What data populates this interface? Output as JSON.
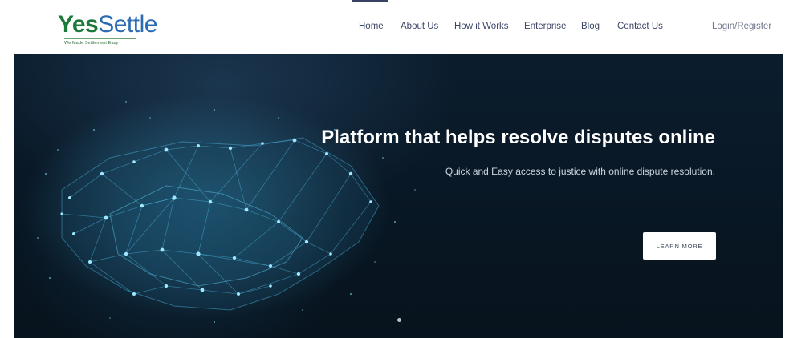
{
  "brand": {
    "name_part1": "Yes",
    "name_part2": "Settle",
    "tagline": "We Made Settlement Easy"
  },
  "nav": {
    "items": [
      {
        "label": "Home",
        "active": true
      },
      {
        "label": "About Us"
      },
      {
        "label": "How it Works"
      },
      {
        "label": "Enterprise"
      },
      {
        "label": "Blog"
      },
      {
        "label": "Contact Us"
      }
    ],
    "login_label": "Login/Register"
  },
  "hero": {
    "title": "Platform that helps resolve disputes online",
    "subtitle": "Quick and Easy access to justice with online dispute resolution.",
    "button_label": "LEARN MORE",
    "image_icon": "handshake-network-icon",
    "slides_visible_dots": 1
  },
  "colors": {
    "brand_green": "#1b7a3a",
    "brand_blue": "#2b6bb3",
    "nav_text": "#3d4668",
    "hero_bg": "#0a1b2a",
    "hero_glow": "#48c8f0"
  }
}
